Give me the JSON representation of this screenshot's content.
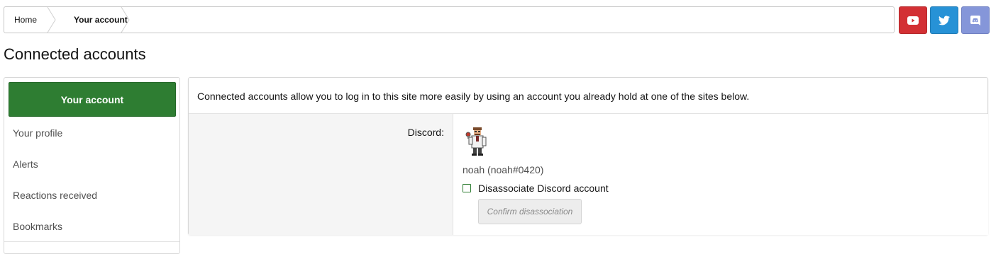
{
  "breadcrumb": {
    "items": [
      {
        "label": "Home"
      },
      {
        "label": "Your account"
      }
    ]
  },
  "social": {
    "youtube": {
      "icon": "youtube-icon",
      "color": "#d33034"
    },
    "twitter": {
      "icon": "twitter-icon",
      "color": "#2792d6"
    },
    "discord": {
      "icon": "discord-icon",
      "color": "#8596d9"
    }
  },
  "page": {
    "title": "Connected accounts"
  },
  "sidebar": {
    "active_label": "Your account",
    "active_color": "#2e7d32",
    "items": [
      {
        "label": "Your profile"
      },
      {
        "label": "Alerts"
      },
      {
        "label": "Reactions received"
      },
      {
        "label": "Bookmarks"
      }
    ]
  },
  "main": {
    "intro": "Connected accounts allow you to log in to this site more easily by using an account you already hold at one of the sites below.",
    "provider_label": "Discord:",
    "account_display": "noah (noah#0420)",
    "disassociate_label": "Disassociate Discord account",
    "disassociate_checked": false,
    "confirm_label": "Confirm disassociation"
  }
}
